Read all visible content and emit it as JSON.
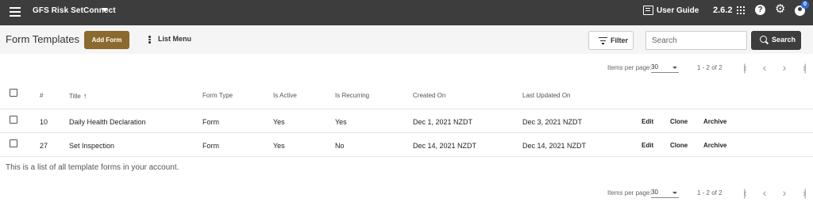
{
  "topbar": {
    "app_title": "GFS Risk SetConnect",
    "user_guide_label": "User Guide",
    "version": "2.6.2",
    "notification_count": "0",
    "background": "#3d3d3d"
  },
  "header": {
    "title": "Form Templates",
    "add_form_label": "Add Form",
    "list_menu_label": "List Menu",
    "filter_label": "Filter",
    "search_placeholder": "Search",
    "search_button_label": "Search",
    "accent_color": "#8b6a2f"
  },
  "paginator": {
    "items_per_page_label": "Items per page:",
    "items_per_page_value": "30",
    "range_label": "1 - 2 of 2"
  },
  "table": {
    "columns": [
      "#",
      "Title",
      "Form Type",
      "Is Active",
      "Is Recurring",
      "Created On",
      "Last Updated On"
    ],
    "rows": [
      {
        "id": "10",
        "title": "Daily Health Declaration",
        "form_type": "Form",
        "is_active": "Yes",
        "is_recurring": "Yes",
        "created_on": "Dec 1, 2021 NZDT",
        "last_updated_on": "Dec 3, 2021 NZDT",
        "actions": [
          "Edit",
          "Clone",
          "Archive"
        ]
      },
      {
        "id": "27",
        "title": "Set Inspection",
        "form_type": "Form",
        "is_active": "Yes",
        "is_recurring": "No",
        "created_on": "Dec 14, 2021 NZDT",
        "last_updated_on": "Dec 14, 2021 NZDT",
        "actions": [
          "Edit",
          "Clone",
          "Archive"
        ]
      }
    ]
  },
  "footer_note": "This is a list of all template forms in your account."
}
